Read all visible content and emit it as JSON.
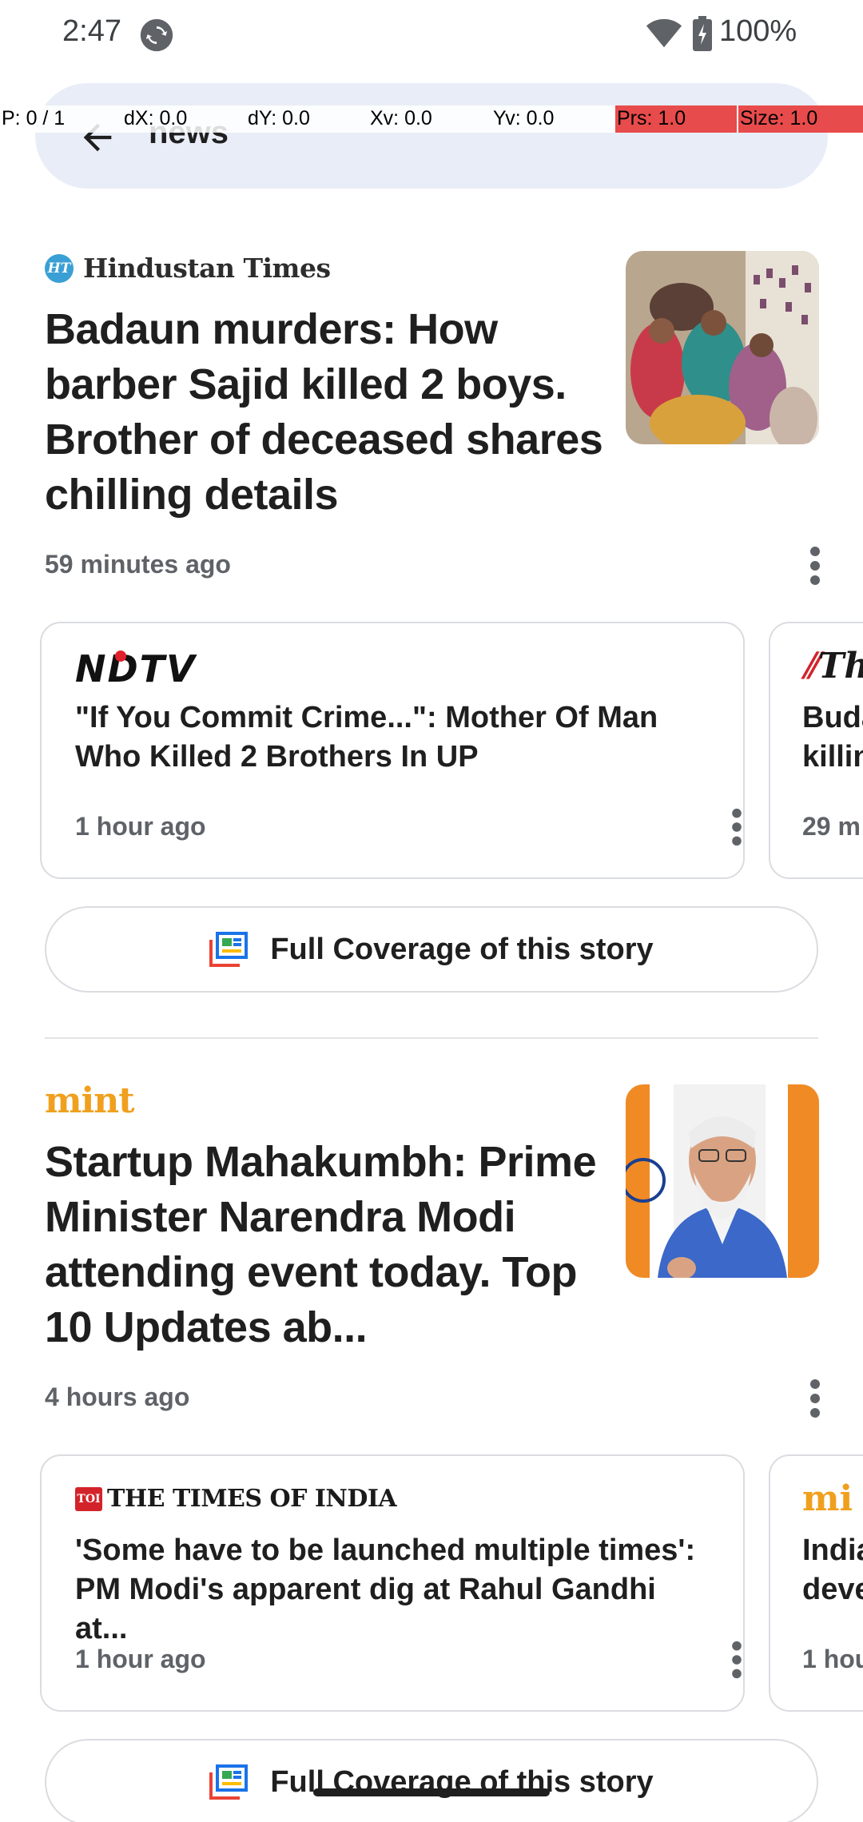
{
  "status_bar": {
    "time": "2:47",
    "battery": "100%"
  },
  "search": {
    "query": "news"
  },
  "debug_overlay": {
    "p": "P: 0 / 1",
    "dx": "dX: 0.0",
    "dy": "dY: 0.0",
    "xv": "Xv: 0.0",
    "yv": "Yv: 0.0",
    "prs": "Prs: 1.0",
    "size": "Size: 1.0"
  },
  "stories": [
    {
      "source": "Hindustan Times",
      "source_badge": "HT",
      "headline": "Badaun murders: How barber Sajid killed 2 boys. Brother of deceased shares chilling details",
      "time": "59 minutes ago",
      "related": [
        {
          "source": "NDTV",
          "title": "\"If You Commit Crime...\": Mother Of Man Who Killed 2 Brothers In UP",
          "time": "1 hour ago"
        },
        {
          "source": "Th",
          "title_line1": "Buda",
          "title_line2": "killin",
          "time": "29 m"
        }
      ],
      "coverage_label": "Full Coverage of this story"
    },
    {
      "source": "mint",
      "headline": "Startup Mahakumbh: Prime Minister Narendra Modi attending event today. Top 10 Updates ab...",
      "time": "4 hours ago",
      "related": [
        {
          "source": "THE TIMES OF INDIA",
          "source_badge": "TOI",
          "title": "'Some have to be launched multiple times': PM Modi's apparent dig at Rahul Gandhi at...",
          "time": "1 hour ago"
        },
        {
          "source": "mi",
          "title_line1": "India",
          "title_line2": "deve",
          "time": "1 hou"
        }
      ],
      "coverage_label": "Full Coverage of this story"
    }
  ],
  "colors": {
    "search_pill": "#e9edf7",
    "debug_highlight": "#e84b4b",
    "mint_brand": "#f0a01e",
    "toi_brand": "#d3232a",
    "ndtv_dot": "#e0202a",
    "ht_badge": "#3a9fd5"
  },
  "icons": [
    "sync-icon",
    "wifi-icon",
    "battery-icon",
    "back-arrow-icon",
    "more-vert-icon",
    "full-coverage-icon"
  ]
}
